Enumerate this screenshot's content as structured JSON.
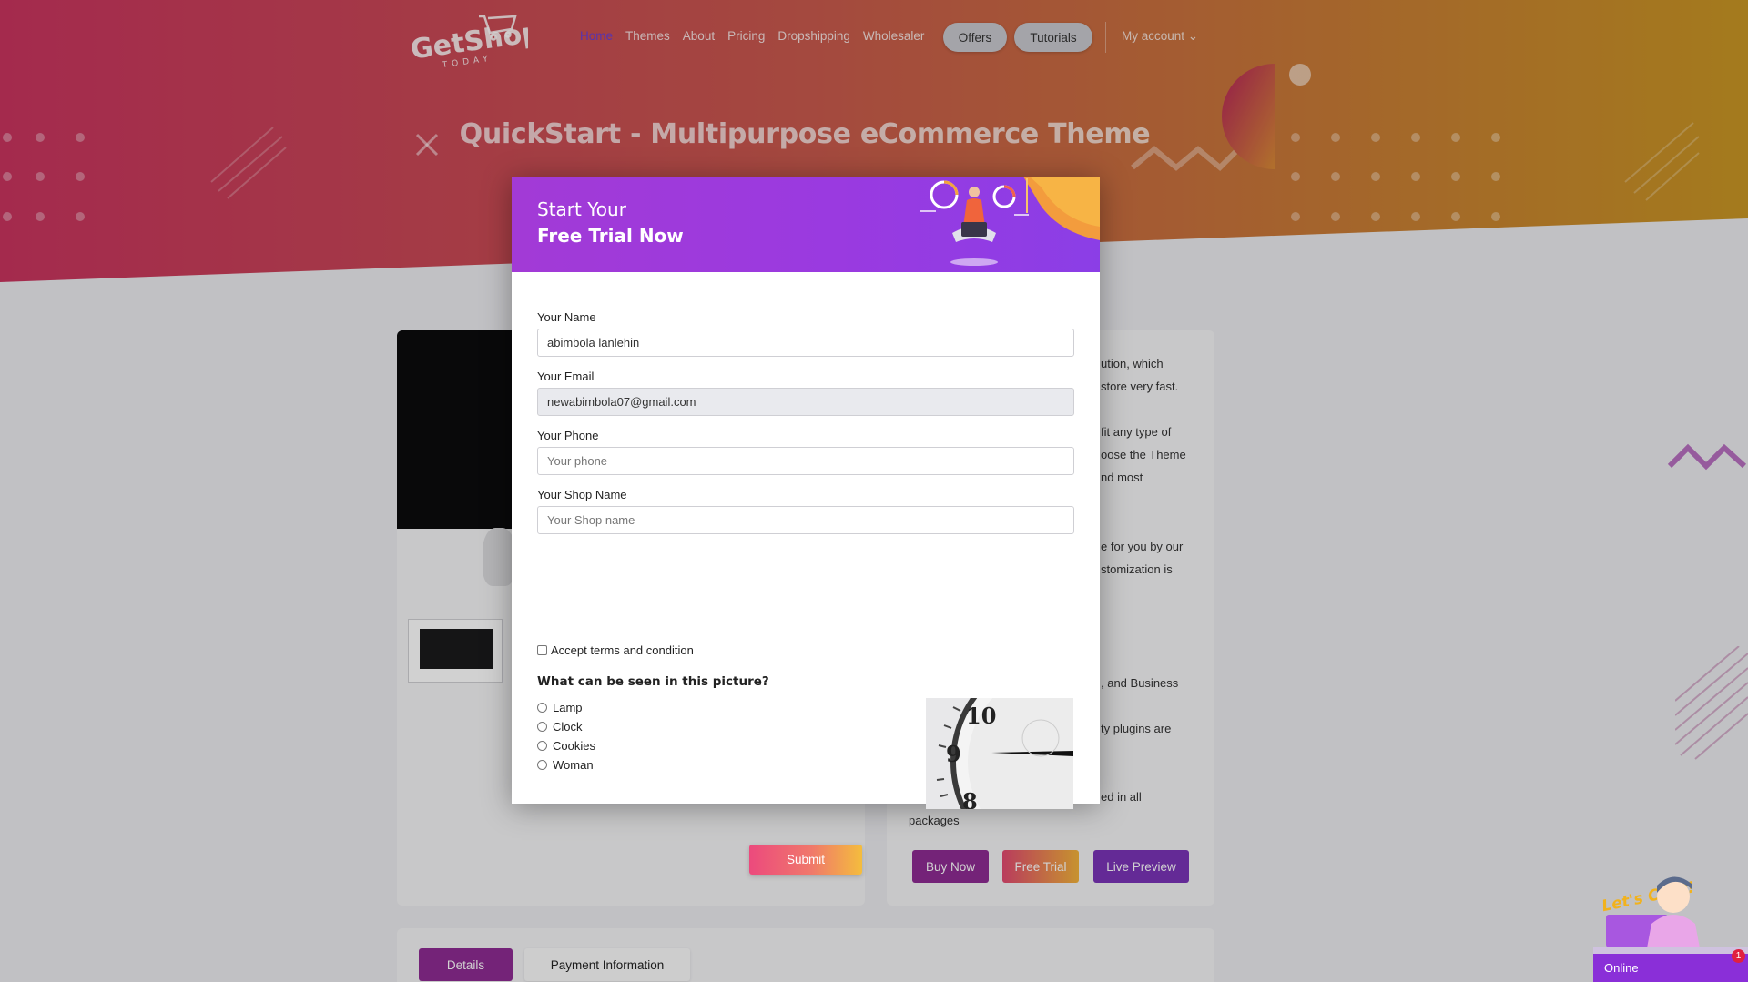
{
  "nav": {
    "logo_text": "GetShop",
    "logo_sub": "TODAY",
    "links": [
      "Home",
      "Themes",
      "About",
      "Pricing",
      "Dropshipping",
      "Wholesaler"
    ],
    "offers": "Offers",
    "tutorials": "Tutorials",
    "account": "My account ⌄"
  },
  "hero": {
    "title": "QuickStart - Multipurpose eCommerce Theme"
  },
  "description": {
    "lines": [
      "ution, which",
      "store very fast.",
      "fit any type of",
      "oose the Theme",
      "nd most",
      "e for you by our",
      "stomization is",
      ", and Business",
      "ty plugins are",
      "ed in all",
      "packages"
    ]
  },
  "product_buttons": {
    "buy_now": "Buy Now",
    "free_trial": "Free Trial",
    "live_preview": "Live Preview"
  },
  "tabs": {
    "details": "Details",
    "payment": "Payment Information"
  },
  "modal": {
    "title_line1": "Start Your",
    "title_line2": "Free Trial Now",
    "fields": {
      "name_label": "Your Name",
      "name_value": "abimbola lanlehin",
      "email_label": "Your Email",
      "email_value": "newabimbola07@gmail.com",
      "phone_label": "Your Phone",
      "phone_placeholder": "Your phone",
      "shop_label": "Your Shop Name",
      "shop_placeholder": "Your Shop name"
    },
    "terms": "Accept terms and condition",
    "question": "What can be seen in this picture?",
    "options": [
      "Lamp",
      "Clock",
      "Cookies",
      "Woman"
    ],
    "captcha_numbers": [
      "10",
      "9",
      "8"
    ],
    "submit": "Submit"
  },
  "chat": {
    "bubble": "Let's Chat!",
    "status": "Online",
    "badge": "1"
  },
  "colors": {
    "hero_left": "#c8345f",
    "hero_right": "#c99624",
    "modal_header": "#9b3ae0",
    "brand_purple": "#8e2b93",
    "active_link": "#6b3fd6"
  }
}
